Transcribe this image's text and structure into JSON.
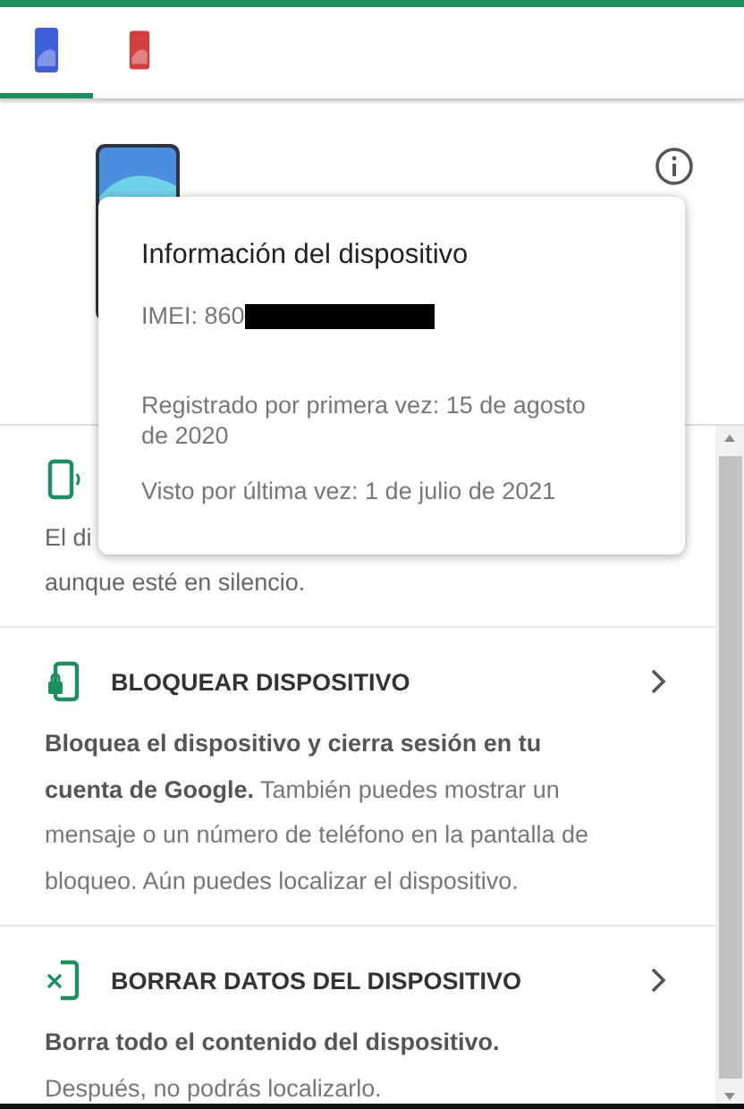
{
  "tabs": [
    {
      "kind": "phone",
      "color": "#3f5fd8",
      "selected": true
    },
    {
      "kind": "phone",
      "color": "#d0403f",
      "selected": false
    }
  ],
  "device_info_popup": {
    "title": "Información del dispositivo",
    "imei": "IMEI: 860",
    "first_registered": "Registrado por primera vez: 15 de agosto de 2020",
    "last_seen": "Visto por última vez: 1 de julio de 2021"
  },
  "actions": [
    {
      "kind": "sound",
      "description_lines": [
        "El di",
        "aunque esté en silencio."
      ]
    },
    {
      "kind": "lock",
      "title": "BLOQUEAR DISPOSITIVO",
      "description": "**Bloquea el dispositivo y cierra sesión en tu cuenta de Google.** También puedes mostrar un mensaje o un número de teléfono en la pantalla de bloqueo. Aún puedes localizar el dispositivo."
    },
    {
      "kind": "erase",
      "title": "BORRAR DATOS DEL DISPOSITIVO",
      "description": "**Borra todo el contenido del dispositivo.** Después, no podrás localizarlo."
    }
  ]
}
